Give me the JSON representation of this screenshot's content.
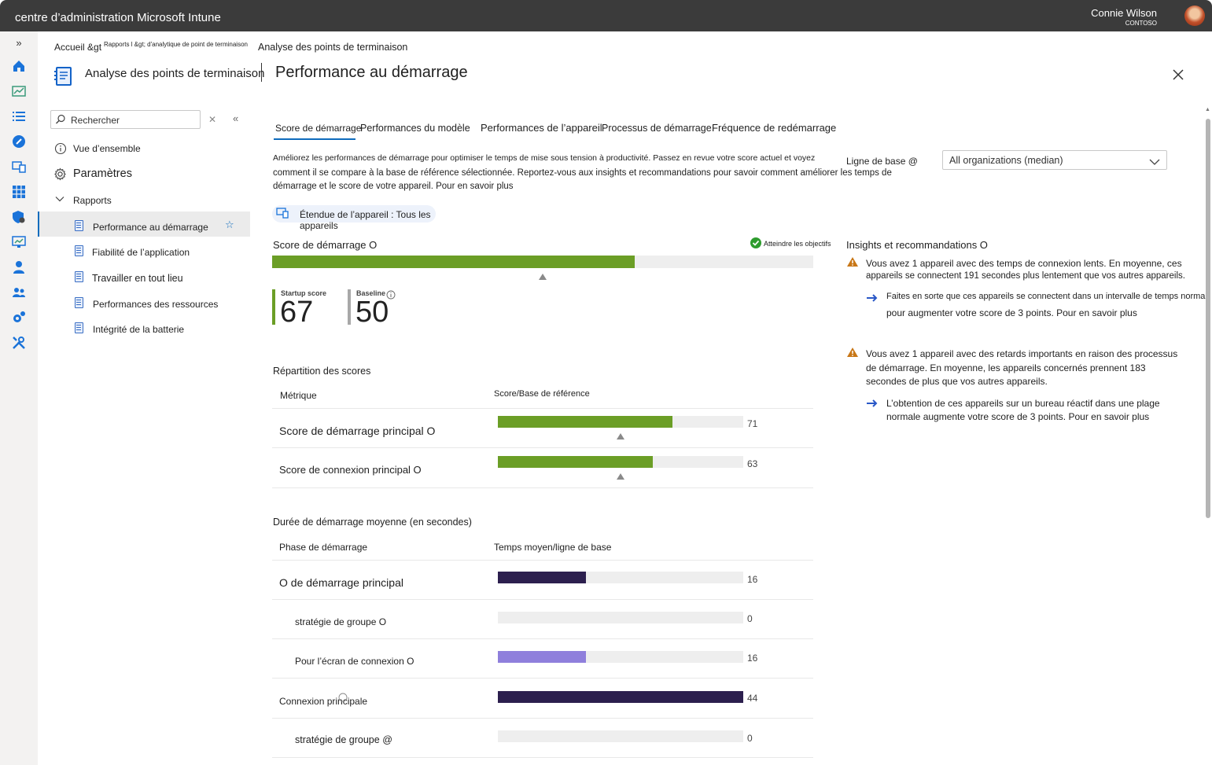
{
  "app": {
    "title": "centre d’administration Microsoft Intune",
    "user_name": "Connie Wilson",
    "user_org": "CONTOSO"
  },
  "breadcrumb": {
    "home": "Accueil &gt",
    "reports": "Rapports l &gt; d'analytique de point de terminaison",
    "current": "Analyse des points de terminaison"
  },
  "blade": {
    "parent_title": "Analyse des points de terminaison",
    "title": "Performance au démarrage"
  },
  "nav": {
    "search_placeholder": "Rechercher",
    "overview": "Vue d’ensemble",
    "settings": "Paramètres",
    "reports": "Rapports",
    "items": [
      {
        "label": "Performance au démarrage"
      },
      {
        "label": "Fiabilité de l’application"
      },
      {
        "label": "Travailler en tout lieu"
      },
      {
        "label": "Performances des ressources"
      },
      {
        "label": "Intégrité de la batterie"
      }
    ]
  },
  "tabs": [
    {
      "label": "Score de démarrage"
    },
    {
      "label": "Performances du modèle"
    },
    {
      "label": "Performances de l’appareil"
    },
    {
      "label": "Processus de démarrage"
    },
    {
      "label": "Fréquence de redémarrage"
    }
  ],
  "intro": {
    "line1": "Améliorez les performances de démarrage pour optimiser le temps de mise sous tension à productivité. Passez en revue votre score actuel et voyez",
    "line2": "comment il se compare à la base de référence sélectionnée. Reportez-vous aux insights et recommandations pour savoir comment améliorer les temps de",
    "line3": "démarrage et le score de votre appareil. Pour en savoir plus"
  },
  "baseline": {
    "label": "Ligne de base @",
    "selected": "All organizations (median)"
  },
  "scope": {
    "label": "Étendue de l’appareil : Tous les appareils"
  },
  "score": {
    "title": "Score de démarrage O",
    "goal_label": "Atteindre les objectifs",
    "fill": 0.67,
    "baseline_marker": 0.5,
    "startup_label": "Startup score",
    "startup_value": "67",
    "baseline_label": "Baseline",
    "baseline_value": "50"
  },
  "breakdown": {
    "title": "Répartition des scores",
    "col_metric": "Métrique",
    "col_score": "Score/Base de référence",
    "rows": [
      {
        "label": "Score de démarrage principal O",
        "value": "71",
        "fill": 0.71,
        "marker": 0.5
      },
      {
        "label": "Score de connexion principal O",
        "value": "63",
        "fill": 0.63,
        "marker": 0.5
      }
    ]
  },
  "duration": {
    "title": "Durée de démarrage moyenne (en secondes)",
    "col_phase": "Phase de démarrage",
    "col_time": "Temps moyen/ligne de base",
    "rows": [
      {
        "label": "O de démarrage principal",
        "value": "16",
        "fill": 0.36,
        "color": "#2c1f4e"
      },
      {
        "label": "stratégie de groupe O",
        "value": "0",
        "fill": 0,
        "color": "#2c1f4e"
      },
      {
        "label": "Pour l’écran de connexion O",
        "value": "16",
        "fill": 0.36,
        "color": "#8f7fdc"
      },
      {
        "label": "Connexion principale",
        "value": "44",
        "fill": 1.0,
        "color": "#2c1f4e"
      },
      {
        "label": "stratégie de groupe @",
        "value": "0",
        "fill": 0,
        "color": "#2c1f4e"
      }
    ]
  },
  "insights": {
    "title": "Insights et recommandations O",
    "items": [
      {
        "warning1": "Vous avez 1 appareil avec des temps de connexion lents. En moyenne, ces",
        "warning2": "appareils se connectent 191 secondes plus lentement que vos autres appareils.",
        "action1": "Faites en sorte que ces appareils se connectent dans un intervalle de temps normal",
        "action2": "pour augmenter votre score de 3 points. Pour en savoir plus"
      },
      {
        "warning1": "Vous avez 1 appareil avec des retards importants en raison des processus",
        "warning2": "de démarrage. En moyenne, les appareils concernés prennent 183",
        "warning3": "secondes de plus que vos autres appareils.",
        "action1": "L’obtention de ces appareils sur un bureau réactif dans une plage",
        "action2": "normale augmente votre score de 3 points. Pour en savoir plus"
      }
    ]
  },
  "colors": {
    "green": "#6b9e26",
    "accent": "#0f6cbd",
    "warning": "#c87717"
  }
}
